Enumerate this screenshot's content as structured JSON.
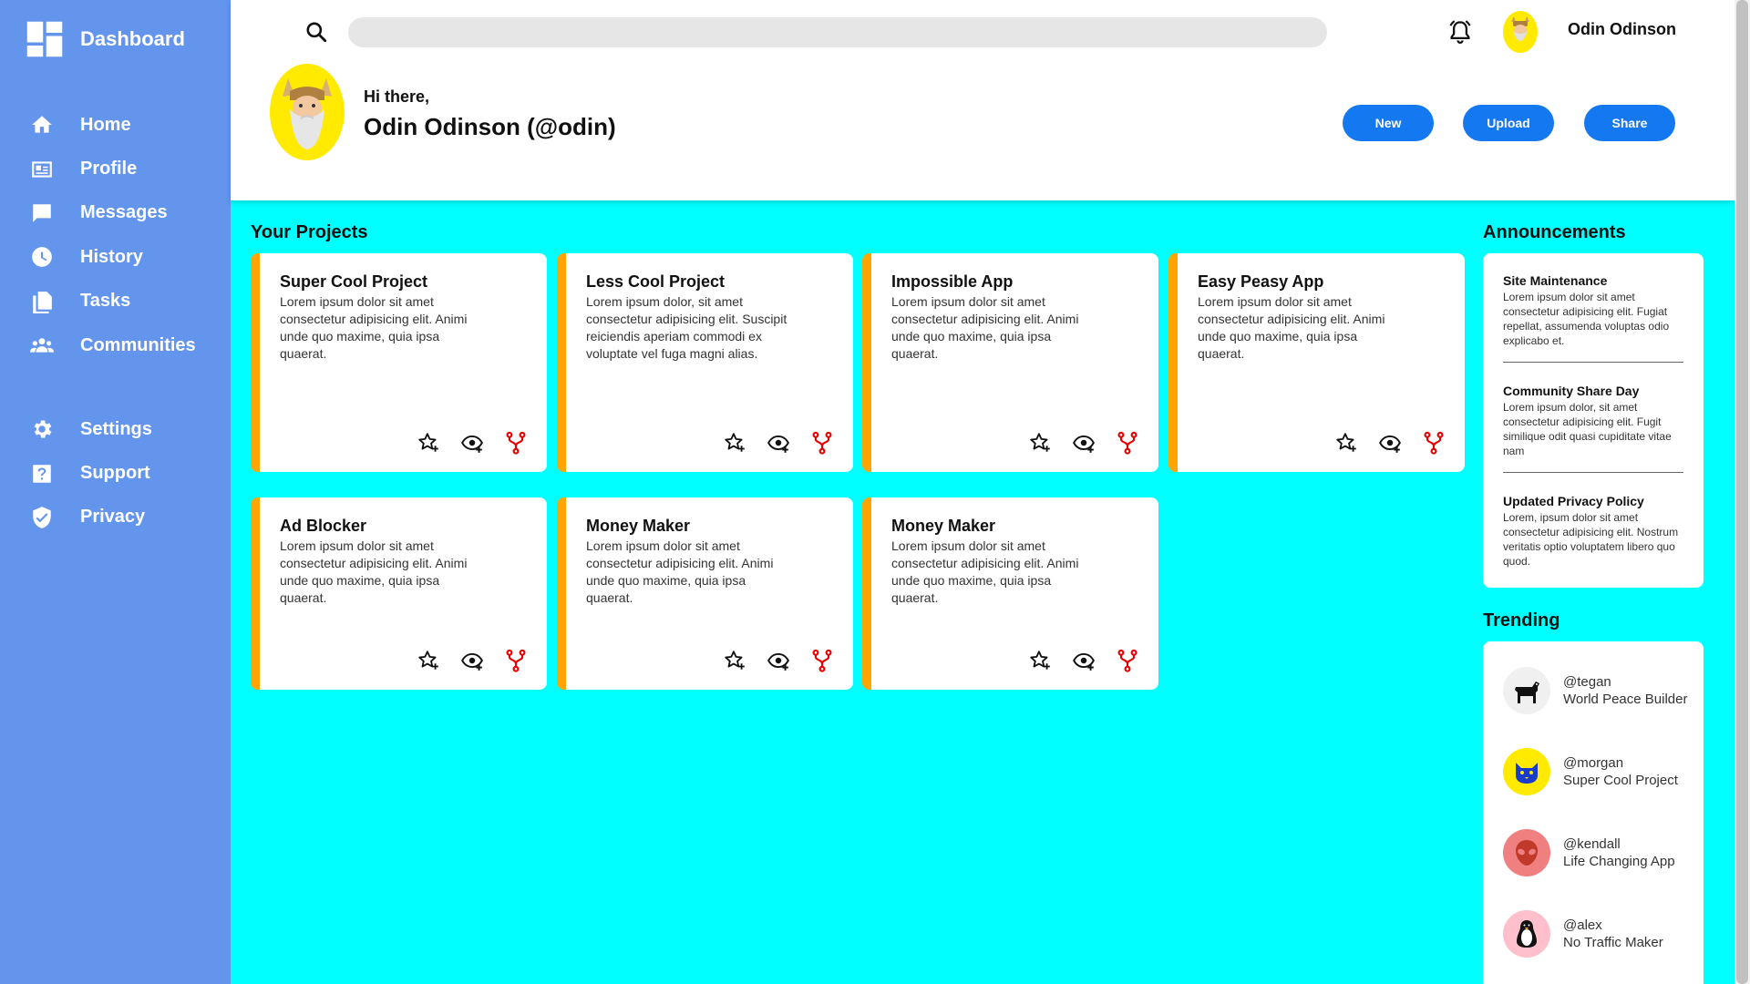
{
  "sidebar": {
    "brand": "Dashboard",
    "items": [
      {
        "label": "Home",
        "icon": "home-icon"
      },
      {
        "label": "Profile",
        "icon": "id-card-icon"
      },
      {
        "label": "Messages",
        "icon": "message-icon"
      },
      {
        "label": "History",
        "icon": "clock-icon"
      },
      {
        "label": "Tasks",
        "icon": "documents-icon"
      },
      {
        "label": "Communities",
        "icon": "group-icon"
      }
    ],
    "items2": [
      {
        "label": "Settings",
        "icon": "gear-icon"
      },
      {
        "label": "Support",
        "icon": "help-icon"
      },
      {
        "label": "Privacy",
        "icon": "shield-icon"
      }
    ]
  },
  "header": {
    "search_value": "",
    "user_name": "Odin Odinson",
    "greeting": "Hi there,",
    "user_handle": "Odin Odinson (@odin)",
    "buttons": {
      "new": "New",
      "upload": "Upload",
      "share": "Share"
    },
    "colors": {
      "button": "#1478f0"
    }
  },
  "projects": {
    "title": "Your Projects",
    "items": [
      {
        "title": "Super Cool Project",
        "desc": "Lorem ipsum dolor sit amet consectetur adipisicing elit. Animi unde quo maxime, quia ipsa quaerat."
      },
      {
        "title": "Less Cool Project",
        "desc": "Lorem ipsum dolor, sit amet consectetur adipisicing elit. Suscipit reiciendis aperiam commodi ex voluptate vel fuga magni alias."
      },
      {
        "title": "Impossible App",
        "desc": "Lorem ipsum dolor sit amet consectetur adipisicing elit. Animi unde quo maxime, quia ipsa quaerat."
      },
      {
        "title": "Easy Peasy App",
        "desc": "Lorem ipsum dolor sit amet consectetur adipisicing elit. Animi unde quo maxime, quia ipsa quaerat."
      },
      {
        "title": "Ad Blocker",
        "desc": "Lorem ipsum dolor sit amet consectetur adipisicing elit. Animi unde quo maxime, quia ipsa quaerat."
      },
      {
        "title": "Money Maker",
        "desc": "Lorem ipsum dolor sit amet consectetur adipisicing elit. Animi unde quo maxime, quia ipsa quaerat."
      },
      {
        "title": "Money Maker",
        "desc": "Lorem ipsum dolor sit amet consectetur adipisicing elit. Animi unde quo maxime, quia ipsa quaerat."
      }
    ]
  },
  "announcements": {
    "title": "Announcements",
    "items": [
      {
        "title": "Site Maintenance",
        "body": "Lorem ipsum dolor sit amet consectetur adipisicing elit. Fugiat repellat, assumenda voluptas odio explicabo et."
      },
      {
        "title": "Community Share Day",
        "body": "Lorem ipsum dolor, sit amet consectetur adipisicing elit. Fugit similique odit quasi cupiditate vitae nam"
      },
      {
        "title": "Updated Privacy Policy",
        "body": "Lorem, ipsum dolor sit amet consectetur adipisicing elit. Nostrum veritatis optio voluptatem libero quo quod."
      }
    ]
  },
  "trending": {
    "title": "Trending",
    "items": [
      {
        "handle": "@tegan",
        "project": "World Peace Builder",
        "icon": "dog-icon"
      },
      {
        "handle": "@morgan",
        "project": "Super Cool Project",
        "icon": "cat-icon"
      },
      {
        "handle": "@kendall",
        "project": "Life Changing App",
        "icon": "alien-icon"
      },
      {
        "handle": "@alex",
        "project": "No Traffic Maker",
        "icon": "penguin-icon"
      }
    ]
  },
  "colors": {
    "sidebar": "#6495ed",
    "main_bg": "#00ffff",
    "card_accent": "#ffa500",
    "fork_icon": "#e60000"
  }
}
